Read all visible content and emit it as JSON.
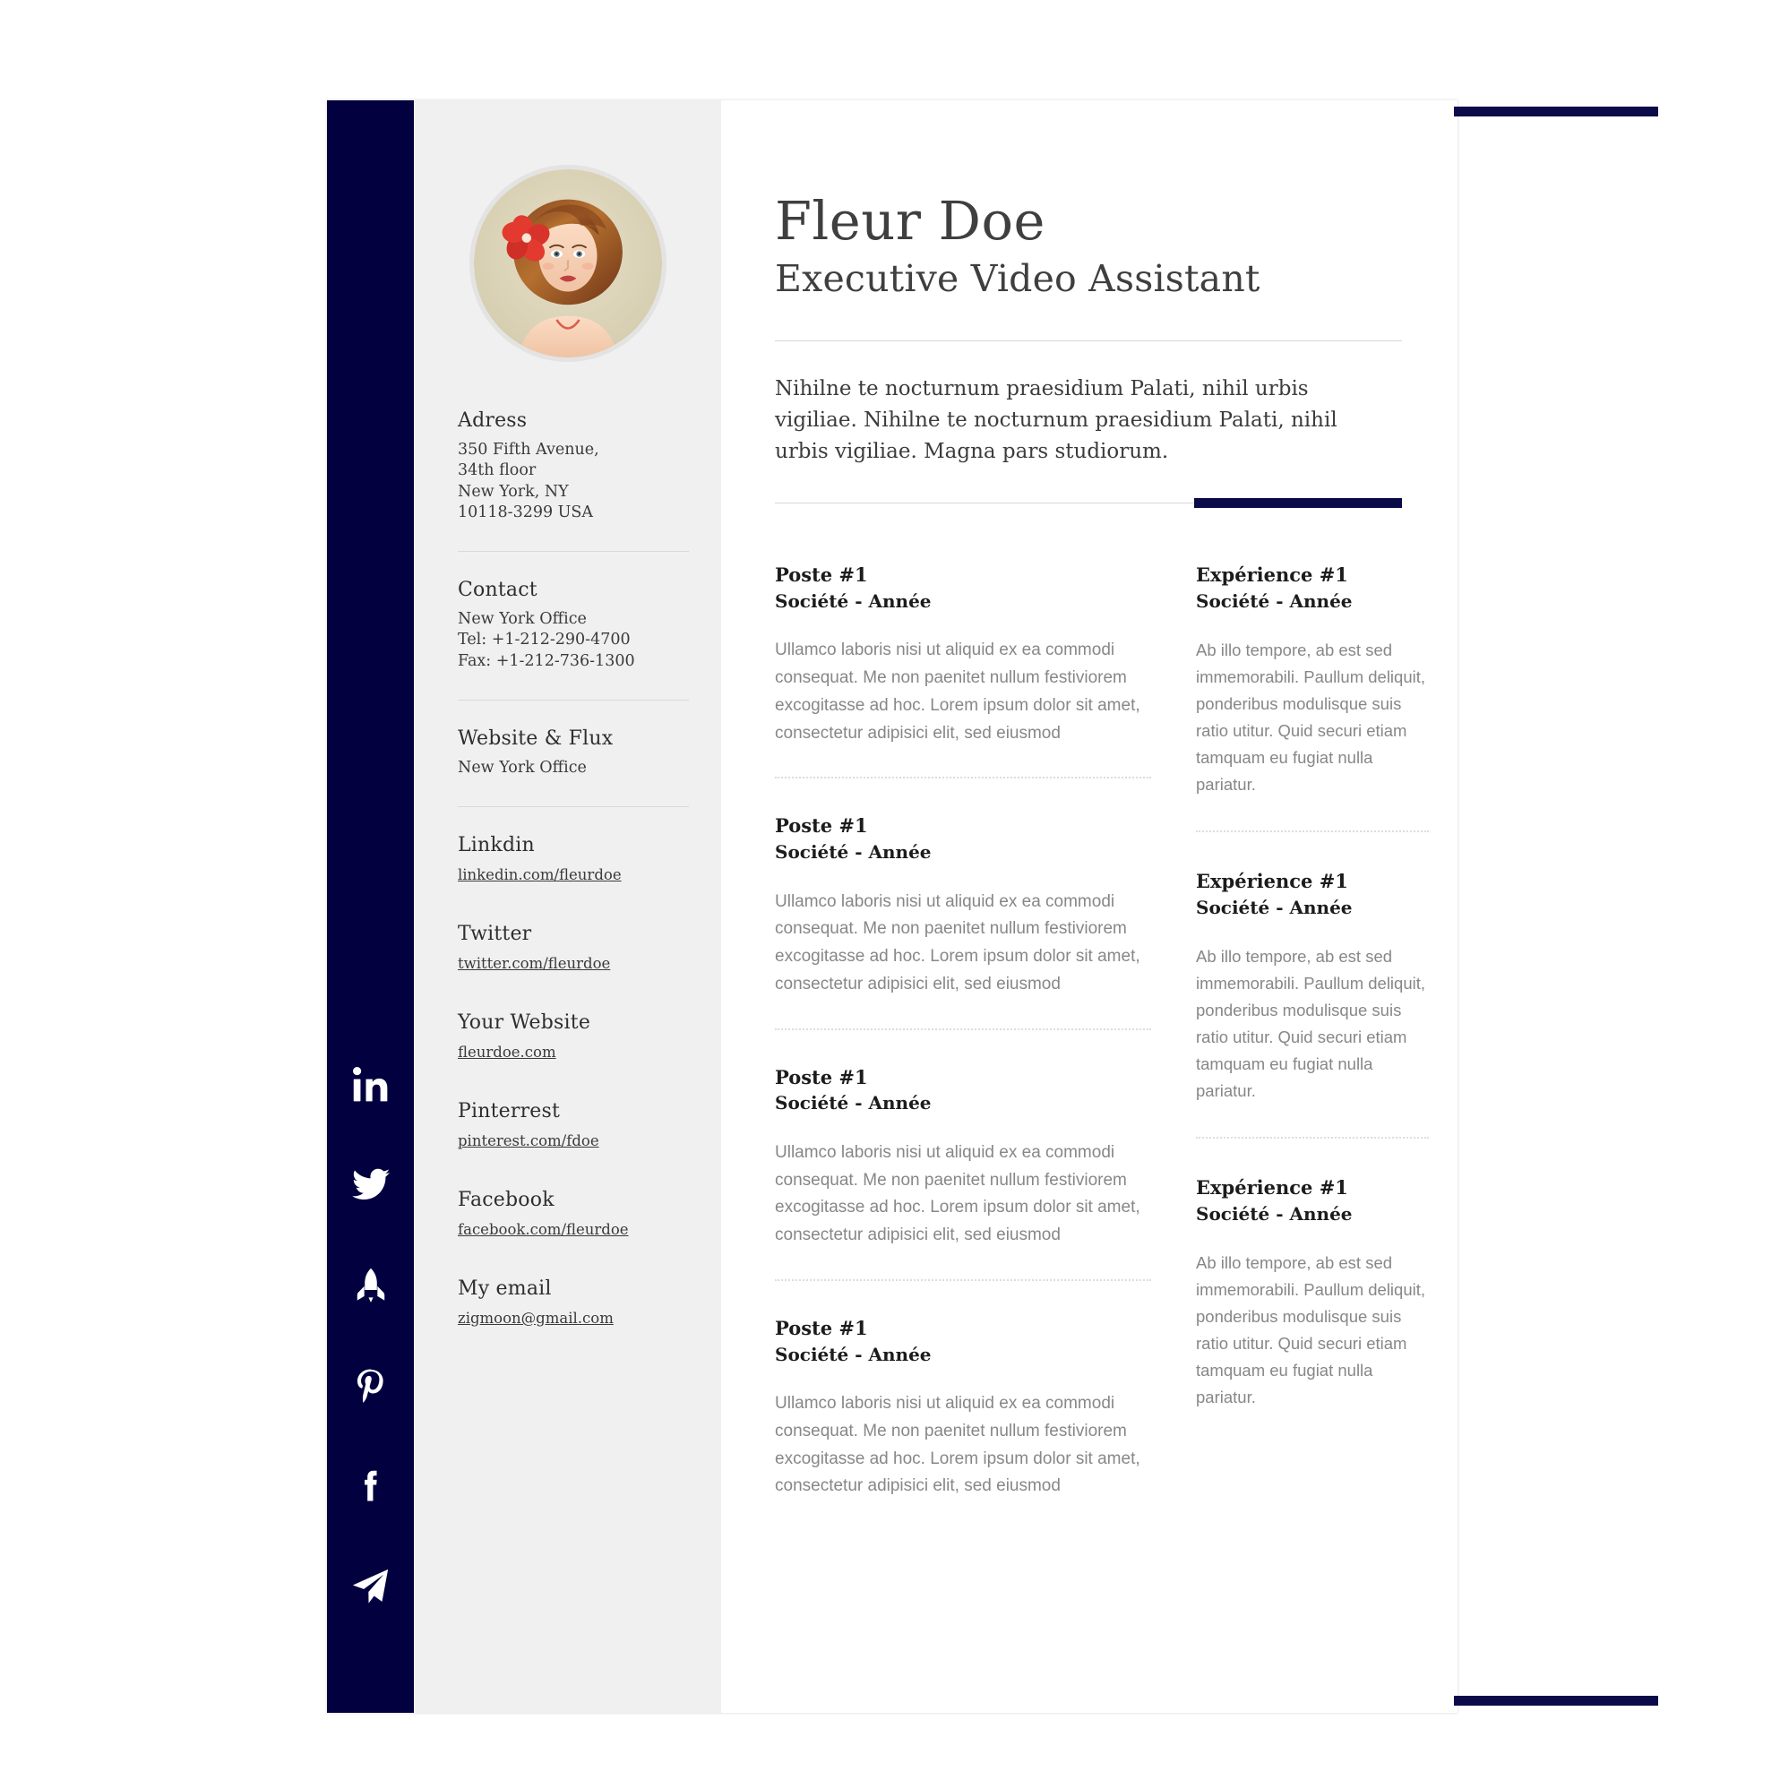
{
  "theme": {
    "navy": "#02003f",
    "accent_navy": "#0b0b4a",
    "sidebar_bg": "#f0f0f0",
    "page_bg": "#ffffff",
    "body_text": "#878787",
    "heading_text": "#1c1c1c"
  },
  "header": {
    "name": "Fleur Doe",
    "job_title": "Executive Video Assistant",
    "intro": "Nihilne te nocturnum praesidium Palati, nihil urbis vigiliae. Nihilne te nocturnum praesidium Palati, nihil urbis vigiliae. Magna pars studiorum."
  },
  "sidebar": {
    "avatar_alt": "illustrated portrait of a woman with auburn hair and a red hibiscus flower",
    "address": {
      "heading": "Adress",
      "line1": "350 Fifth Avenue,",
      "line2": "34th floor",
      "line3": "New York, NY",
      "line4": "10118-3299 USA"
    },
    "contact": {
      "heading": "Contact",
      "office": "New York Office",
      "tel": "Tel: +1-212-290-4700",
      "fax": "Fax: +1-212-736-1300"
    },
    "website_flux": {
      "heading": "Website & Flux",
      "office": "New York Office"
    },
    "social": [
      {
        "icon": "linkedin-icon",
        "heading": "Linkdin",
        "url": "linkedin.com/fleurdoe"
      },
      {
        "icon": "twitter-icon",
        "heading": "Twitter",
        "url": "twitter.com/fleurdoe"
      },
      {
        "icon": "rocket-icon",
        "heading": "Your Website",
        "url": "fleurdoe.com"
      },
      {
        "icon": "pinterest-icon",
        "heading": "Pinterrest",
        "url": "pinterest.com/fdoe"
      },
      {
        "icon": "facebook-icon",
        "heading": "Facebook",
        "url": "facebook.com/fleurdoe"
      },
      {
        "icon": "paper-plane-icon",
        "heading": "My email",
        "url": "zigmoon@gmail.com"
      }
    ]
  },
  "main": {
    "positions": [
      {
        "title": "Poste #1",
        "subtitle": "Société - Année",
        "body": "Ullamco laboris nisi ut aliquid ex ea commodi consequat. Me non paenitet nullum festiviorem excogitasse ad hoc. Lorem ipsum dolor sit amet, consectetur adipisici elit, sed eiusmod"
      },
      {
        "title": "Poste #1",
        "subtitle": "Société - Année",
        "body": "Ullamco laboris nisi ut aliquid ex ea commodi consequat. Me non paenitet nullum festiviorem excogitasse ad hoc. Lorem ipsum dolor sit amet, consectetur adipisici elit, sed eiusmod"
      },
      {
        "title": "Poste #1",
        "subtitle": "Société - Année",
        "body": "Ullamco laboris nisi ut aliquid ex ea commodi consequat. Me non paenitet nullum festiviorem excogitasse ad hoc. Lorem ipsum dolor sit amet, consectetur adipisici elit, sed eiusmod"
      },
      {
        "title": "Poste #1",
        "subtitle": "Société - Année",
        "body": "Ullamco laboris nisi ut aliquid ex ea commodi consequat. Me non paenitet nullum festiviorem excogitasse ad hoc. Lorem ipsum dolor sit amet, consectetur adipisici elit, sed eiusmod"
      }
    ],
    "experiences": [
      {
        "title": "Expérience #1",
        "subtitle": "Société - Année",
        "body": "Ab illo tempore, ab est sed immemorabili. Paullum deliquit, ponderibus modulisque suis ratio utitur. Quid securi etiam tamquam eu fugiat nulla pariatur."
      },
      {
        "title": "Expérience #1",
        "subtitle": "Société - Année",
        "body": "Ab illo tempore, ab est sed immemorabili. Paullum deliquit, ponderibus modulisque suis ratio utitur. Quid securi etiam tamquam eu fugiat nulla pariatur."
      },
      {
        "title": "Expérience #1",
        "subtitle": "Société - Année",
        "body": "Ab illo tempore, ab est sed immemorabili. Paullum deliquit, ponderibus modulisque suis ratio utitur. Quid securi etiam tamquam eu fugiat nulla pariatur."
      }
    ]
  }
}
